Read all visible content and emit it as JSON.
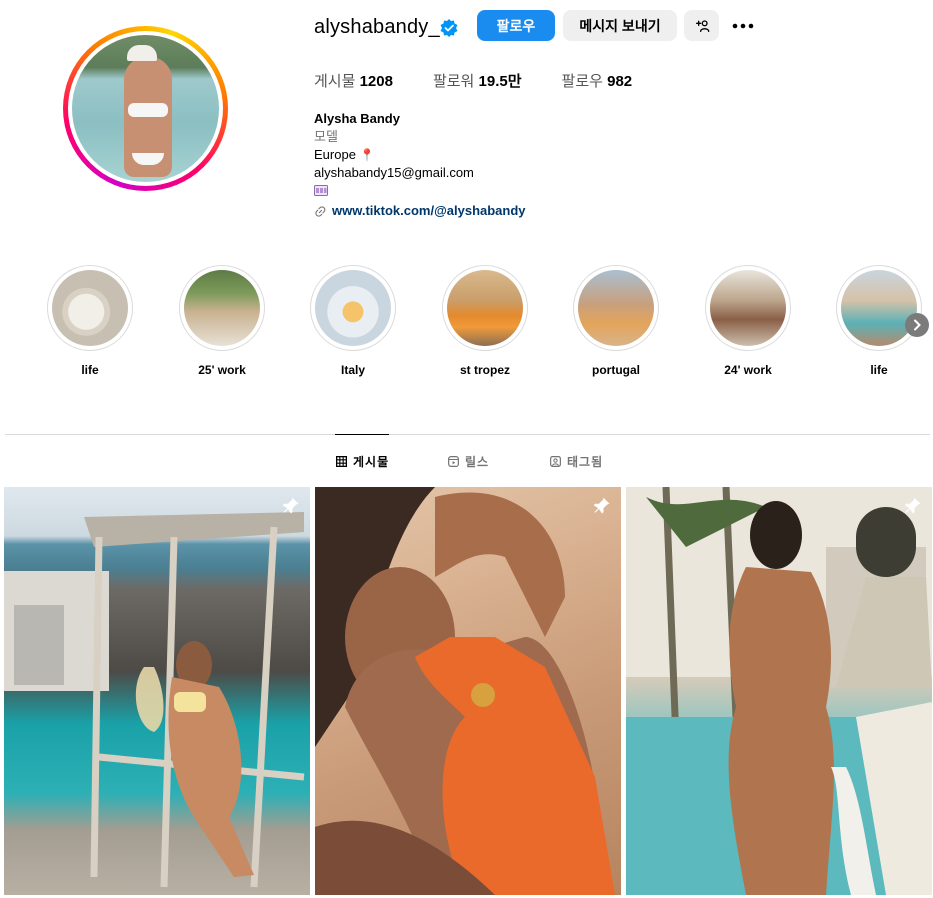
{
  "profile": {
    "username": "alyshabandy_",
    "verified": true,
    "follow_label": "팔로우",
    "message_label": "메시지 보내기",
    "add_user_icon": "add-user-icon",
    "more_icon": "more-options-icon"
  },
  "stats": {
    "posts_label": "게시물",
    "posts_value": "1208",
    "followers_label": "팔로워",
    "followers_value": "19.5만",
    "following_label": "팔로우",
    "following_value": "982"
  },
  "bio": {
    "name": "Alysha Bandy",
    "category": "모델",
    "location": "Europe",
    "location_emoji": "📍",
    "email": "alyshabandy15@gmail.com",
    "film_icon": "film-frames-icon",
    "link": "www.tiktok.com/@alyshabandy"
  },
  "highlights": [
    {
      "label": "life"
    },
    {
      "label": "25' work"
    },
    {
      "label": "Italy"
    },
    {
      "label": "st tropez"
    },
    {
      "label": "portugal"
    },
    {
      "label": "24' work"
    },
    {
      "label": "life"
    }
  ],
  "tabs": [
    {
      "label": "게시물",
      "icon": "grid-icon",
      "active": true
    },
    {
      "label": "릴스",
      "icon": "reels-icon",
      "active": false
    },
    {
      "label": "태그됨",
      "icon": "tagged-icon",
      "active": false
    }
  ],
  "posts": [
    {
      "pinned": true
    },
    {
      "pinned": true
    },
    {
      "pinned": true
    }
  ],
  "colors": {
    "follow_button": "#1a8cf0",
    "secondary_button": "#efefef",
    "link": "#00376b",
    "verified_badge": "#0095f6"
  }
}
